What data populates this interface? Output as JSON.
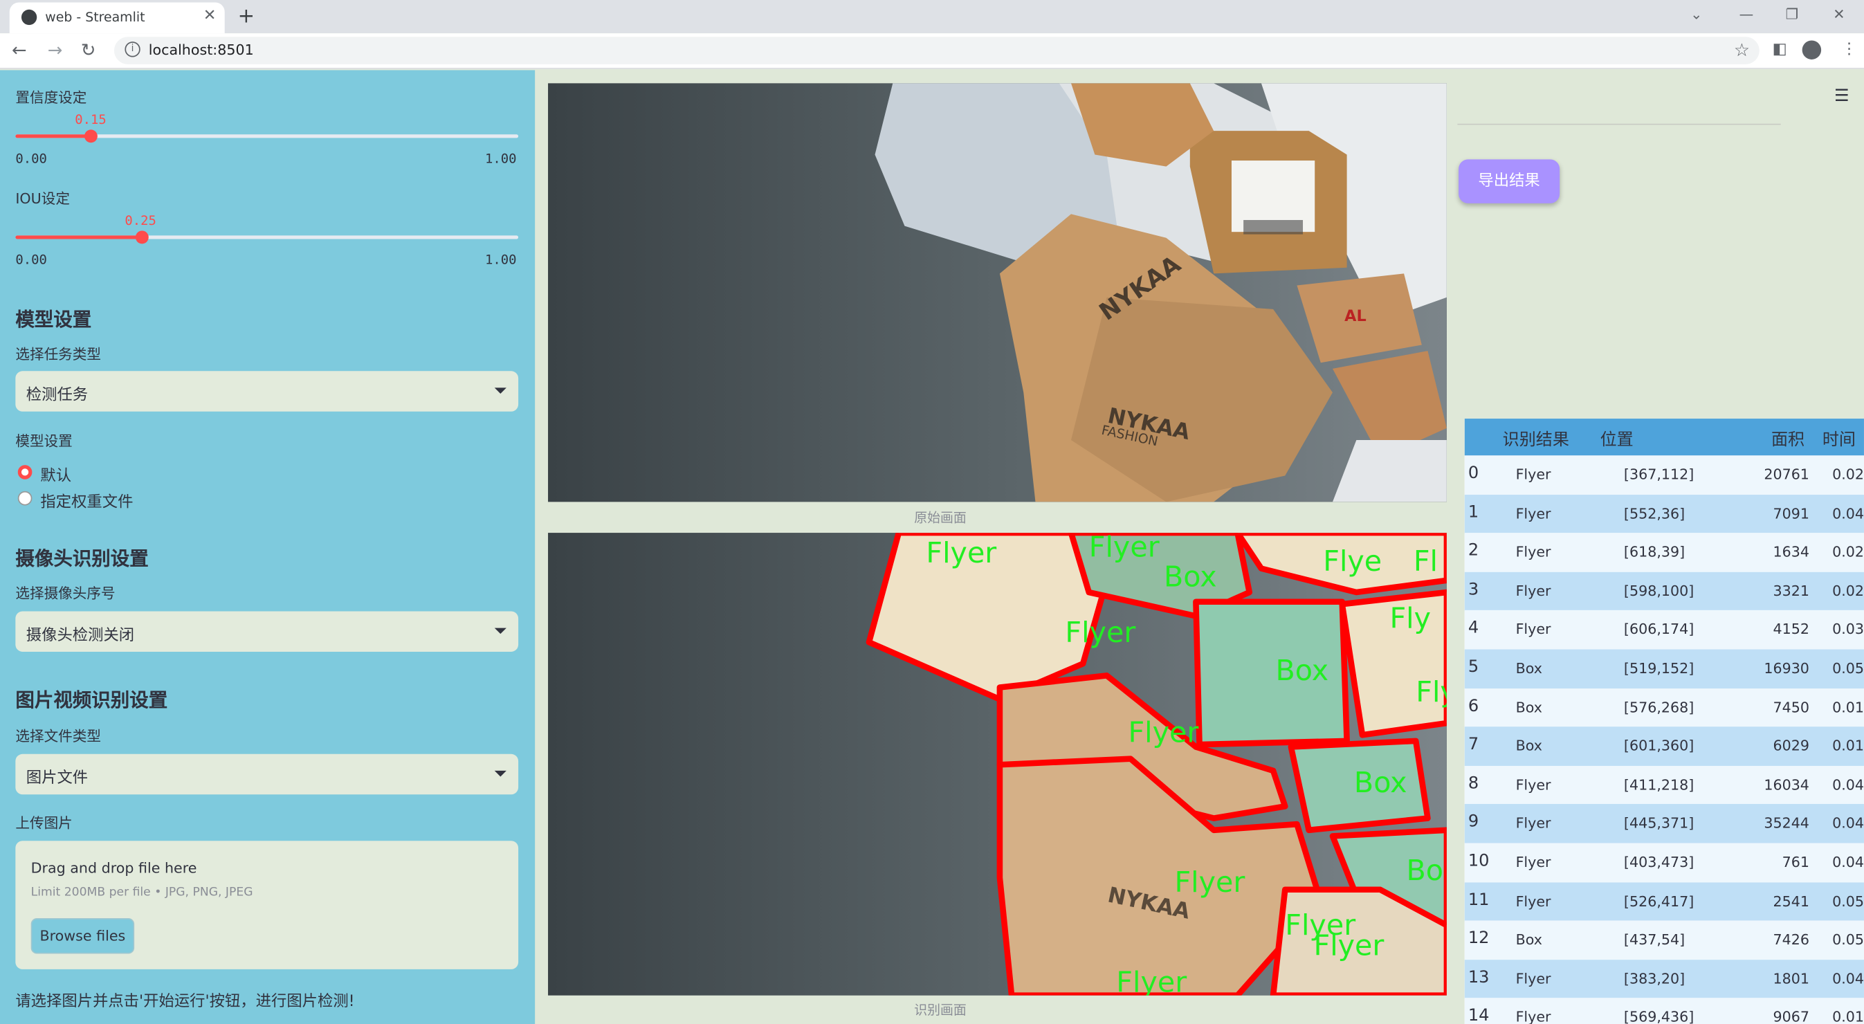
{
  "browser": {
    "tab_title": "web - Streamlit",
    "url": "localhost:8501"
  },
  "sidebar": {
    "confidence": {
      "label": "置信度设定",
      "value": "0.15",
      "fraction": 0.15,
      "min": "0.00",
      "max": "1.00"
    },
    "iou": {
      "label": "IOU设定",
      "value": "0.25",
      "fraction": 0.25,
      "min": "0.00",
      "max": "1.00"
    },
    "model_section": {
      "title": "模型设置",
      "task_label": "选择任务类型",
      "task_value": "检测任务",
      "model_label": "模型设置",
      "options": [
        "默认",
        "指定权重文件"
      ],
      "selected": 0
    },
    "camera_section": {
      "title": "摄像头识别设置",
      "camera_label": "选择摄像头序号",
      "camera_value": "摄像头检测关闭"
    },
    "media_section": {
      "title": "图片视频识别设置",
      "file_type_label": "选择文件类型",
      "file_type_value": "图片文件",
      "upload_label": "上传图片",
      "drop_text": "Drag and drop file here",
      "limit_text": "Limit 200MB per file • JPG, PNG, JPEG",
      "browse_label": "Browse files"
    },
    "hint": "请选择图片并点击'开始运行'按钮，进行图片检测!"
  },
  "main": {
    "original_caption": "原始画面",
    "result_caption": "识别画面",
    "detection_labels": [
      "Flyer",
      "Flyer",
      "Box",
      "Flyer",
      "Flye",
      "Fl",
      "Fly",
      "Box",
      "Fly",
      "Flyer",
      "Box",
      "Flyer",
      "Bo",
      "Flyer",
      "Flyer",
      "Flyer"
    ],
    "print_text": [
      "NYKAA",
      "FASHION",
      "AL"
    ]
  },
  "right": {
    "export_label": "导出结果",
    "table": {
      "headers": [
        "",
        "识别结果",
        "位置",
        "面积",
        "时间"
      ],
      "rows": [
        [
          "0",
          "Flyer",
          "[367,112]",
          "20761",
          "0.02"
        ],
        [
          "1",
          "Flyer",
          "[552,36]",
          "7091",
          "0.04"
        ],
        [
          "2",
          "Flyer",
          "[618,39]",
          "1634",
          "0.02"
        ],
        [
          "3",
          "Flyer",
          "[598,100]",
          "3321",
          "0.02"
        ],
        [
          "4",
          "Flyer",
          "[606,174]",
          "4152",
          "0.03"
        ],
        [
          "5",
          "Box",
          "[519,152]",
          "16930",
          "0.05"
        ],
        [
          "6",
          "Box",
          "[576,268]",
          "7450",
          "0.01"
        ],
        [
          "7",
          "Box",
          "[601,360]",
          "6029",
          "0.01"
        ],
        [
          "8",
          "Flyer",
          "[411,218]",
          "16034",
          "0.04"
        ],
        [
          "9",
          "Flyer",
          "[445,371]",
          "35244",
          "0.04"
        ],
        [
          "10",
          "Flyer",
          "[403,473]",
          "761",
          "0.04"
        ],
        [
          "11",
          "Flyer",
          "[526,417]",
          "2541",
          "0.05"
        ],
        [
          "12",
          "Box",
          "[437,54]",
          "7426",
          "0.05"
        ],
        [
          "13",
          "Flyer",
          "[383,20]",
          "1801",
          "0.04"
        ],
        [
          "14",
          "Flyer",
          "[569,436]",
          "9067",
          "0.01"
        ]
      ]
    }
  },
  "colors": {
    "sidebar_bg": "#7ecadd",
    "main_bg": "#dfe8d8",
    "accent": "#ff4b4b",
    "export_button": "#a992ff",
    "table_header": "#4ea3db",
    "detection_outline": "#ff0000",
    "detection_label": "#22ee22"
  },
  "icons": [
    "streamlit-favicon",
    "close-icon",
    "plus-icon",
    "back-arrow-icon",
    "forward-arrow-icon",
    "reload-icon",
    "info-icon",
    "star-icon",
    "sidepanel-icon",
    "profile-icon",
    "menu-dots-icon",
    "hamburger-menu-icon",
    "chevron-down-icon"
  ]
}
